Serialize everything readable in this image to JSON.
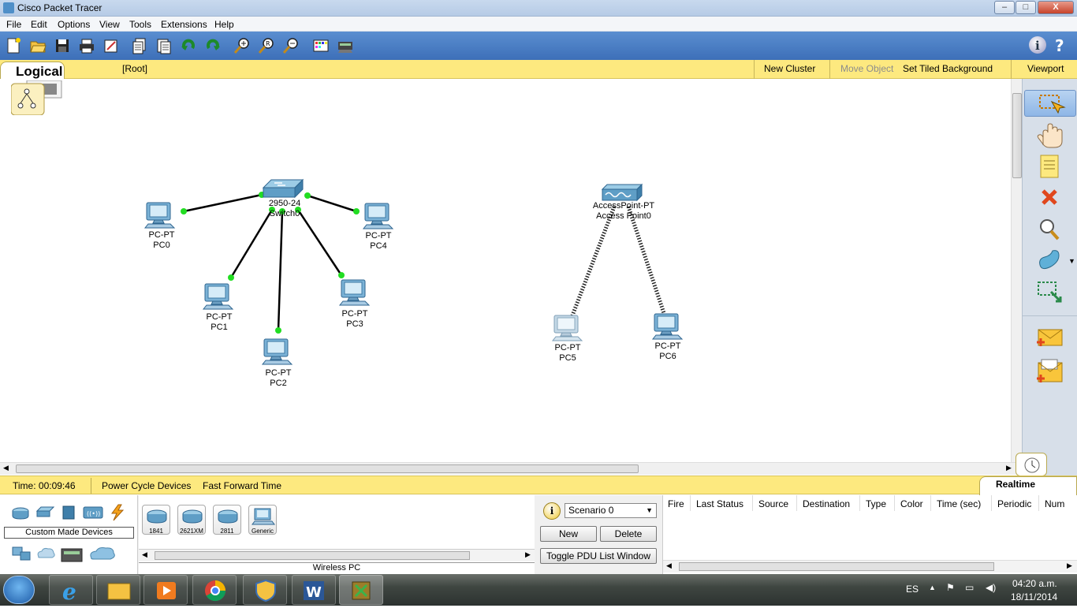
{
  "window": {
    "title": "Cisco Packet Tracer",
    "min": "–",
    "max": "□",
    "close": "X"
  },
  "menu": [
    "File",
    "Edit",
    "Options",
    "View",
    "Tools",
    "Extensions",
    "Help"
  ],
  "logicalbar": {
    "tab": "Logical",
    "root": "[Root]",
    "new_cluster": "New Cluster",
    "move_object": "Move Object",
    "set_tiled_background": "Set Tiled Background",
    "viewport": "Viewport"
  },
  "topology": {
    "switch": {
      "model": "2950-24",
      "name": "Switch0"
    },
    "access_point": {
      "model": "AccessPoint-PT",
      "name": "Access Point0"
    },
    "pcs": [
      {
        "model": "PC-PT",
        "name": "PC0"
      },
      {
        "model": "PC-PT",
        "name": "PC1"
      },
      {
        "model": "PC-PT",
        "name": "PC2"
      },
      {
        "model": "PC-PT",
        "name": "PC3"
      },
      {
        "model": "PC-PT",
        "name": "PC4"
      },
      {
        "model": "PC-PT",
        "name": "PC5"
      },
      {
        "model": "PC-PT",
        "name": "PC6"
      }
    ],
    "link_color": "#000000",
    "port_up_color": "#22dd22"
  },
  "timebar": {
    "time": "Time: 00:09:46",
    "power_cycle": "Power Cycle Devices",
    "fast_forward": "Fast Forward Time",
    "realtime": "Realtime"
  },
  "device_panel": {
    "custom_made": "Custom Made Devices",
    "tiles": [
      "1841",
      "2621XM",
      "2811",
      "Generic"
    ],
    "selected_device": "Wireless PC"
  },
  "scenario": {
    "selected": "Scenario 0",
    "new": "New",
    "delete": "Delete",
    "toggle": "Toggle PDU List Window"
  },
  "pdu_columns": [
    "Fire",
    "Last Status",
    "Source",
    "Destination",
    "Type",
    "Color",
    "Time (sec)",
    "Periodic",
    "Num"
  ],
  "tray": {
    "lang": "ES",
    "time": "04:20 a.m.",
    "date": "18/11/2014"
  },
  "colors": {
    "accent_yellow": "#fde97f",
    "toolbar_blue": "#4a7fc4",
    "device_blue": "#5f9ec6"
  }
}
